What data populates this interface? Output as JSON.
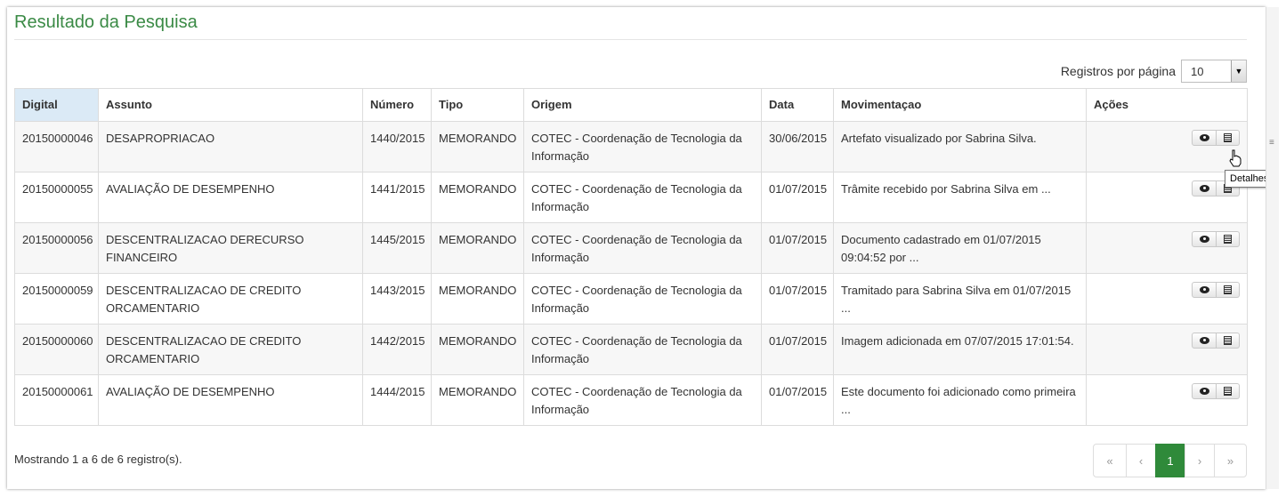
{
  "title": "Resultado da Pesquisa",
  "per_page": {
    "label": "Registros por página",
    "value": "10"
  },
  "table": {
    "headers": [
      "Digital",
      "Assunto",
      "Número",
      "Tipo",
      "Origem",
      "Data",
      "Movimentaçao",
      "Ações"
    ],
    "rows": [
      {
        "digital": "20150000046",
        "assunto": "DESAPROPRIACAO",
        "numero": "1440/2015",
        "tipo": "MEMORANDO",
        "origem": "COTEC - Coordenação de Tecnologia da Informação",
        "data": "30/06/2015",
        "movimentacao": "Artefato visualizado por Sabrina Silva."
      },
      {
        "digital": "20150000055",
        "assunto": "AVALIAÇÃO DE DESEMPENHO",
        "numero": "1441/2015",
        "tipo": "MEMORANDO",
        "origem": "COTEC - Coordenação de Tecnologia da Informação",
        "data": "01/07/2015",
        "movimentacao": "Trâmite recebido por Sabrina Silva em ..."
      },
      {
        "digital": "20150000056",
        "assunto": "DESCENTRALIZACAO DERECURSO FINANCEIRO",
        "numero": "1445/2015",
        "tipo": "MEMORANDO",
        "origem": "COTEC - Coordenação de Tecnologia da Informação",
        "data": "01/07/2015",
        "movimentacao": "Documento cadastrado em 01/07/2015 09:04:52 por ..."
      },
      {
        "digital": "20150000059",
        "assunto": "DESCENTRALIZACAO DE CREDITO ORCAMENTARIO",
        "numero": "1443/2015",
        "tipo": "MEMORANDO",
        "origem": "COTEC - Coordenação de Tecnologia da Informação",
        "data": "01/07/2015",
        "movimentacao": "Tramitado para Sabrina Silva em 01/07/2015 ..."
      },
      {
        "digital": "20150000060",
        "assunto": "DESCENTRALIZACAO DE CREDITO ORCAMENTARIO",
        "numero": "1442/2015",
        "tipo": "MEMORANDO",
        "origem": "COTEC - Coordenação de Tecnologia da Informação",
        "data": "01/07/2015",
        "movimentacao": "Imagem adicionada em 07/07/2015 17:01:54."
      },
      {
        "digital": "20150000061",
        "assunto": "AVALIAÇÃO DE DESEMPENHO",
        "numero": "1444/2015",
        "tipo": "MEMORANDO",
        "origem": "COTEC - Coordenação de Tecnologia da Informação",
        "data": "01/07/2015",
        "movimentacao": "Este documento foi adicionado como primeira ..."
      }
    ]
  },
  "actions": {
    "view_icon": "eye-icon",
    "details_icon": "list-icon"
  },
  "tooltip": "Detalhes",
  "footer": {
    "showing": "Mostrando 1 a 6 de 6 registro(s)."
  },
  "pagination": {
    "first": "«",
    "prev": "‹",
    "current": "1",
    "next": "›",
    "last": "»"
  },
  "colors": {
    "title": "#3a8a45",
    "active_page": "#2f8a3a",
    "sorted_header": "#dbeaf6"
  }
}
